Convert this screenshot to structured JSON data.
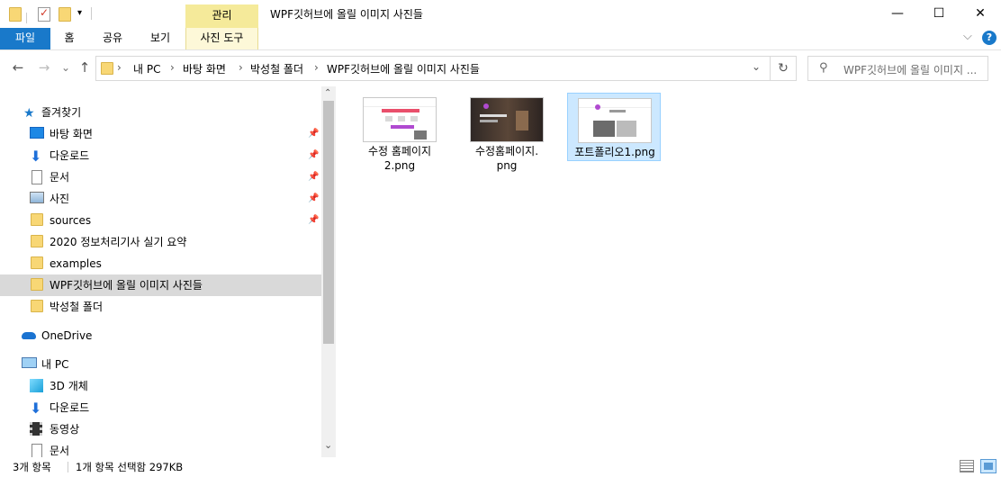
{
  "window": {
    "context_tab_header": "관리",
    "title": "WPF깃허브에 올릴 이미지 사진들",
    "minimize_glyph": "—",
    "maximize_glyph": "☐",
    "close_glyph": "✕"
  },
  "ribbon": {
    "tabs": [
      {
        "label": "파일"
      },
      {
        "label": "홈"
      },
      {
        "label": "공유"
      },
      {
        "label": "보기"
      },
      {
        "label": "사진 도구"
      }
    ],
    "expand_glyph": "⌵",
    "help_glyph": "?"
  },
  "address": {
    "back_glyph": "←",
    "forward_glyph": "→",
    "recent_glyph": "⌄",
    "up_glyph": "↑",
    "crumbs": [
      "내 PC",
      "바탕 화면",
      "박성철 폴더",
      "WPF깃허브에 올릴 이미지 사진들"
    ],
    "separator": "›",
    "dropdown_glyph": "⌄",
    "refresh_glyph": "↻",
    "search_placeholder": "WPF깃허브에 올릴 이미지 ...",
    "search_glyph": "⚲"
  },
  "nav": {
    "quick_access": "즐겨찾기",
    "items": [
      {
        "label": "바탕 화면",
        "pinned": true
      },
      {
        "label": "다운로드",
        "pinned": true
      },
      {
        "label": "문서",
        "pinned": true
      },
      {
        "label": "사진",
        "pinned": true
      },
      {
        "label": "sources",
        "pinned": true
      },
      {
        "label": "2020 정보처리기사 실기 요약"
      },
      {
        "label": "examples"
      },
      {
        "label": "WPF깃허브에 올릴 이미지 사진들",
        "selected": true
      },
      {
        "label": "박성철 폴더"
      }
    ],
    "onedrive": "OneDrive",
    "this_pc": "내 PC",
    "pc_items": [
      {
        "label": "3D 개체"
      },
      {
        "label": "다운로드"
      },
      {
        "label": "동영상"
      },
      {
        "label": "문서"
      }
    ],
    "scroll_up": "⌃",
    "scroll_down": "⌄",
    "pin_glyph": "📌"
  },
  "files": [
    {
      "name_line1": "수정 홈페이지",
      "name_line2": "2.png",
      "selected": false
    },
    {
      "name_line1": "수정홈페이지.",
      "name_line2": "png",
      "selected": false
    },
    {
      "name_line1": "포트폴리오1.png",
      "name_line2": "",
      "selected": true
    }
  ],
  "status": {
    "item_count": "3개 항목",
    "selection": "1개 항목 선택함 297KB"
  },
  "colors": {
    "accent": "#1979ca",
    "selection": "#cce8ff",
    "context_tab": "#f5ea9a"
  }
}
